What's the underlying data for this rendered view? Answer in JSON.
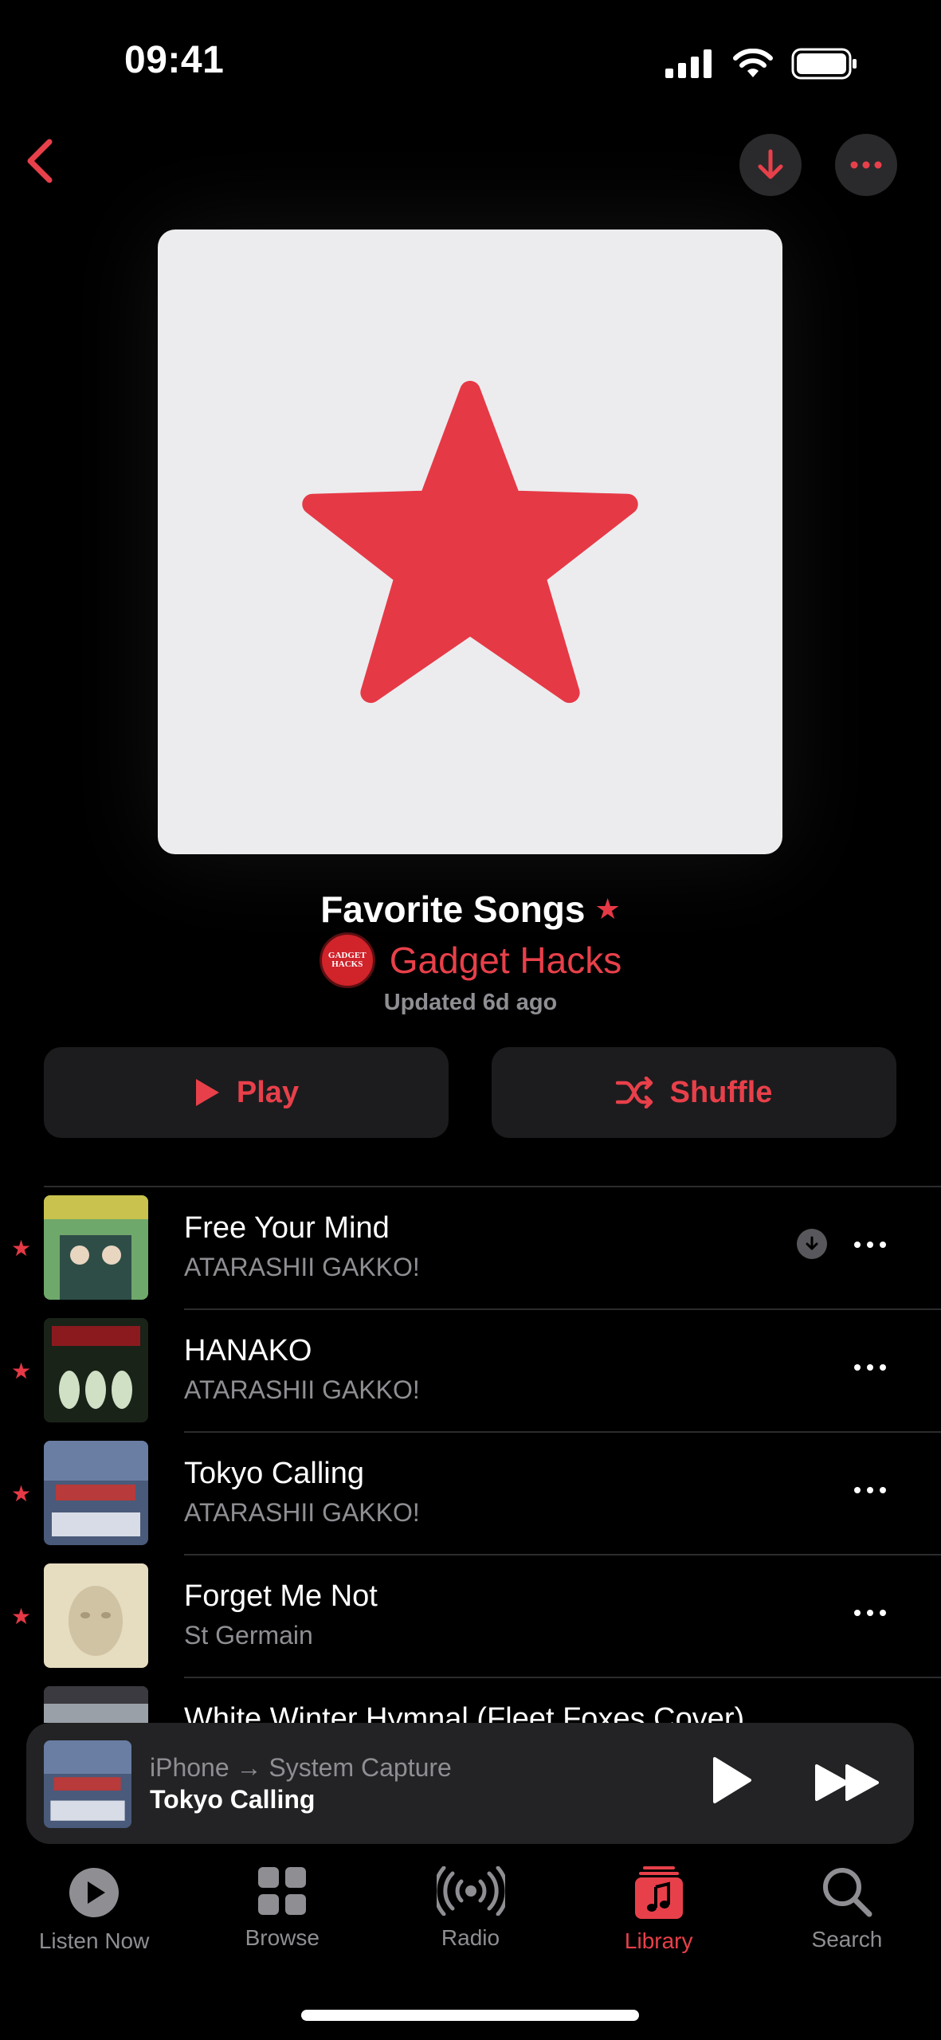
{
  "status_bar": {
    "time": "09:41"
  },
  "playlist": {
    "title": "Favorite Songs",
    "curator": "Gadget Hacks",
    "curator_logo_text": [
      "GADGET",
      "HACKS"
    ],
    "updated": "Updated 6d ago"
  },
  "actions": {
    "play_label": "Play",
    "shuffle_label": "Shuffle"
  },
  "songs": [
    {
      "title": "Free Your Mind",
      "artist": "ATARASHII GAKKO!",
      "favorited": true,
      "downloaded": true
    },
    {
      "title": "HANAKO",
      "artist": "ATARASHII GAKKO!",
      "favorited": true,
      "downloaded": false
    },
    {
      "title": "Tokyo Calling",
      "artist": "ATARASHII GAKKO!",
      "favorited": true,
      "downloaded": false
    },
    {
      "title": "Forget Me Not",
      "artist": "St Germain",
      "favorited": true,
      "downloaded": false
    },
    {
      "title": "White Winter Hymnal (Fleet Foxes Cover)",
      "artist": "",
      "favorited": true,
      "downloaded": false
    }
  ],
  "mini_player": {
    "route": "iPhone → System Capture",
    "title": "Tokyo Calling"
  },
  "tabs": [
    {
      "label": "Listen Now",
      "icon": "play-circle-icon",
      "active": false
    },
    {
      "label": "Browse",
      "icon": "grid-icon",
      "active": false
    },
    {
      "label": "Radio",
      "icon": "radio-icon",
      "active": false
    },
    {
      "label": "Library",
      "icon": "music-note-icon",
      "active": true
    },
    {
      "label": "Search",
      "icon": "search-icon",
      "active": false
    }
  ],
  "colors": {
    "accent": "#e8404a",
    "background": "#000000",
    "artwork_bg": "#ececee",
    "secondary_text": "#8e8e93"
  }
}
